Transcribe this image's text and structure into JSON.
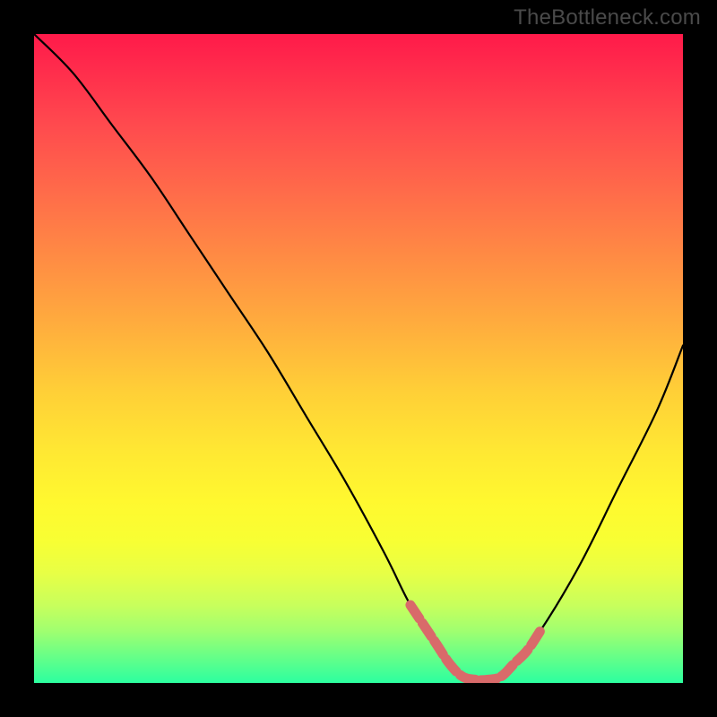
{
  "watermark": "TheBottleneck.com",
  "chart_data": {
    "type": "line",
    "title": "",
    "xlabel": "",
    "ylabel": "",
    "xlim": [
      0,
      100
    ],
    "ylim": [
      0,
      100
    ],
    "grid": false,
    "legend": false,
    "series": [
      {
        "name": "curve",
        "color": "#000000",
        "x": [
          0,
          6,
          12,
          18,
          24,
          30,
          36,
          42,
          48,
          54,
          58,
          62,
          64,
          66,
          68,
          70,
          72,
          74,
          78,
          84,
          90,
          96,
          100
        ],
        "y": [
          100,
          94,
          86,
          78,
          69,
          60,
          51,
          41,
          31,
          20,
          12,
          6,
          3,
          1,
          0.5,
          0.5,
          1,
          3,
          8,
          18,
          30,
          42,
          52
        ]
      },
      {
        "name": "highlight-segment",
        "color": "#d96a6a",
        "x": [
          58,
          60,
          62,
          64,
          66,
          68,
          70,
          72,
          74,
          76,
          78
        ],
        "y": [
          12,
          9,
          6,
          3,
          1,
          0.5,
          0.5,
          1,
          3,
          5,
          8
        ]
      }
    ],
    "annotations": []
  }
}
